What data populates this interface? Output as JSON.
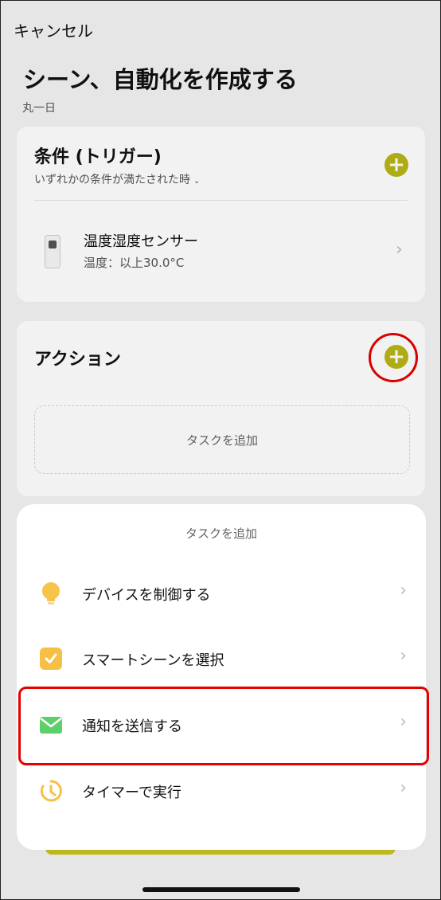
{
  "header": {
    "cancel_label": "キャンセル",
    "title": "シーン、自動化を作成する",
    "subtitle": "丸一日"
  },
  "conditions": {
    "title": "条件 (トリガー)",
    "subtitle": "いずれかの条件が満たされた時",
    "add_label": "+",
    "item": {
      "name": "温度湿度センサー",
      "detail": "温度：以上30.0°C"
    }
  },
  "actions": {
    "title": "アクション",
    "add_label": "+",
    "placeholder": "タスクを追加"
  },
  "sheet": {
    "title": "タスクを追加",
    "items": [
      {
        "label": "デバイスを制御する",
        "icon": "lightbulb-icon"
      },
      {
        "label": "スマートシーンを選択",
        "icon": "checkbox-icon"
      },
      {
        "label": "通知を送信する",
        "icon": "mail-icon"
      },
      {
        "label": "タイマーで実行",
        "icon": "timer-icon"
      }
    ]
  },
  "colors": {
    "accent": "#b8b519",
    "highlight": "#e60000",
    "mail_green": "#5fcf6a",
    "check_yellow": "#f5c045",
    "bulb_yellow": "#f7c44a"
  }
}
